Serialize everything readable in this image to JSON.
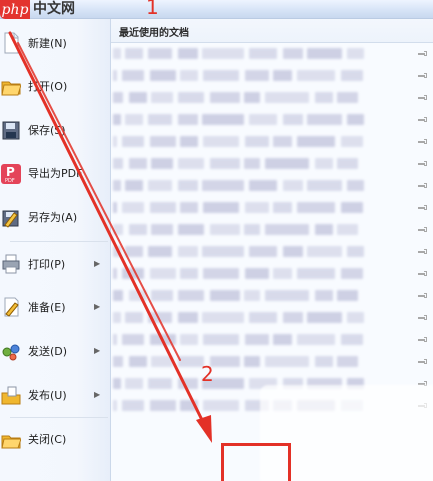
{
  "brand": {
    "logo": "php",
    "name": "中文网"
  },
  "menu": {
    "items": [
      {
        "label": "新建(N)",
        "icon": "new-document-icon",
        "has_submenu": false
      },
      {
        "label": "打开(O)",
        "icon": "open-folder-icon",
        "has_submenu": false
      },
      {
        "label": "保存(S)",
        "icon": "save-disk-icon",
        "has_submenu": false
      },
      {
        "label": "导出为PDF",
        "icon": "pdf-export-icon",
        "has_submenu": false
      },
      {
        "label": "另存为(A)",
        "icon": "save-as-icon",
        "has_submenu": false
      },
      {
        "label": "打印(P)",
        "icon": "printer-icon",
        "has_submenu": true
      },
      {
        "label": "准备(E)",
        "icon": "prepare-icon",
        "has_submenu": true
      },
      {
        "label": "发送(D)",
        "icon": "send-icon",
        "has_submenu": true
      },
      {
        "label": "发布(U)",
        "icon": "publish-icon",
        "has_submenu": true
      },
      {
        "label": "关闭(C)",
        "icon": "close-folder-icon",
        "has_submenu": false
      }
    ],
    "pdf_icon": {
      "letter": "P",
      "subtext": "PDF"
    }
  },
  "recent": {
    "title": "最近使用的文档",
    "document_count": 17
  },
  "annotations": {
    "one": "1",
    "two": "2"
  },
  "colors": {
    "annotation": "#e33127",
    "brand": "#e3342f",
    "blurred_text": "#c7c9e0",
    "menu_background": "#f4f8fe",
    "panel_background": "#f8fbff"
  }
}
